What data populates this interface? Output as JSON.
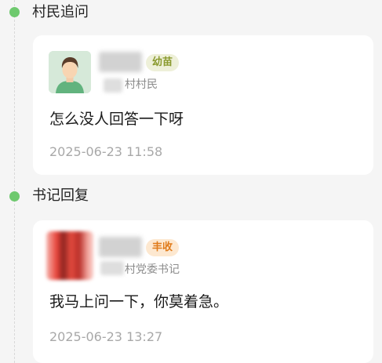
{
  "timeline": [
    {
      "title": "村民追问",
      "author": {
        "badge": "幼苗",
        "role": "村村民"
      },
      "message": "怎么没人回答一下呀",
      "time": "2025-06-23 11:58"
    },
    {
      "title": "书记回复",
      "author": {
        "badge": "丰收",
        "role": "村党委书记"
      },
      "message": "我马上问一下，你莫着急。",
      "time": "2025-06-23 13:27"
    }
  ],
  "colors": {
    "dot": "#6ec96e",
    "badge_seedling": "#8a9a2e",
    "badge_harvest": "#e07b1a"
  },
  "icons": {
    "avatar_1": "villager-avatar-illustration",
    "avatar_2": "blurred-photo-avatar"
  }
}
